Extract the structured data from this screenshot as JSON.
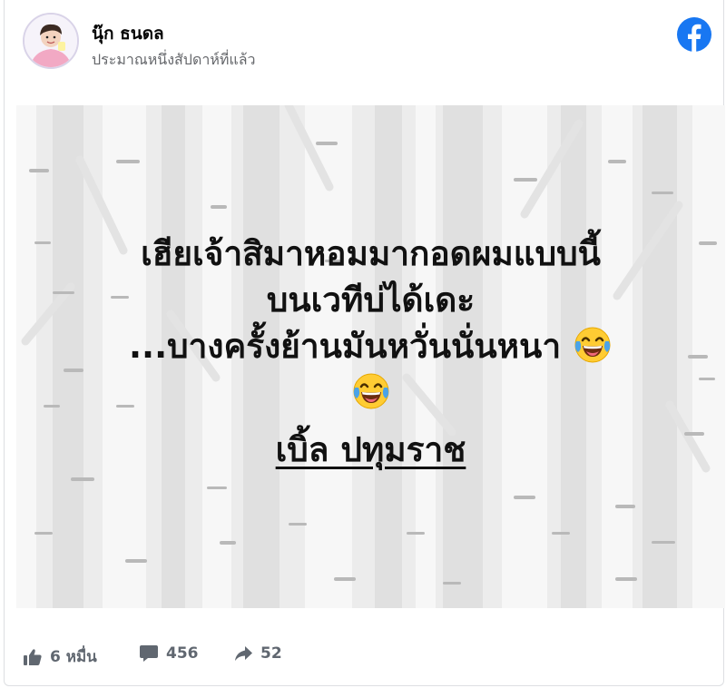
{
  "post": {
    "author": "นุ๊ก ธนดล",
    "timestamp": "ประมาณหนึ่งสัปดาห์ที่แล้ว",
    "content": {
      "line1": "เฮียเจ้าสิมาหอมมากอดผมแบบนี้",
      "line2": "บนเวทีบ่ได้เดะ",
      "line3": "...บางครั้งย้านมันหวั่นนั่นหนา",
      "signature": "เบิ้ล ปทุมราช"
    }
  },
  "stats": {
    "likes": "6 หมื่น",
    "comments": "456",
    "shares": "52"
  },
  "icons": {
    "platform": "facebook-icon",
    "emoji": "face-with-tears-of-joy-icon",
    "like": "thumbs-up-icon",
    "comment": "comment-icon",
    "share": "share-icon"
  },
  "colors": {
    "facebook_blue": "#1877f2",
    "meta_gray": "#65676b",
    "background_gray": "#ececec"
  }
}
